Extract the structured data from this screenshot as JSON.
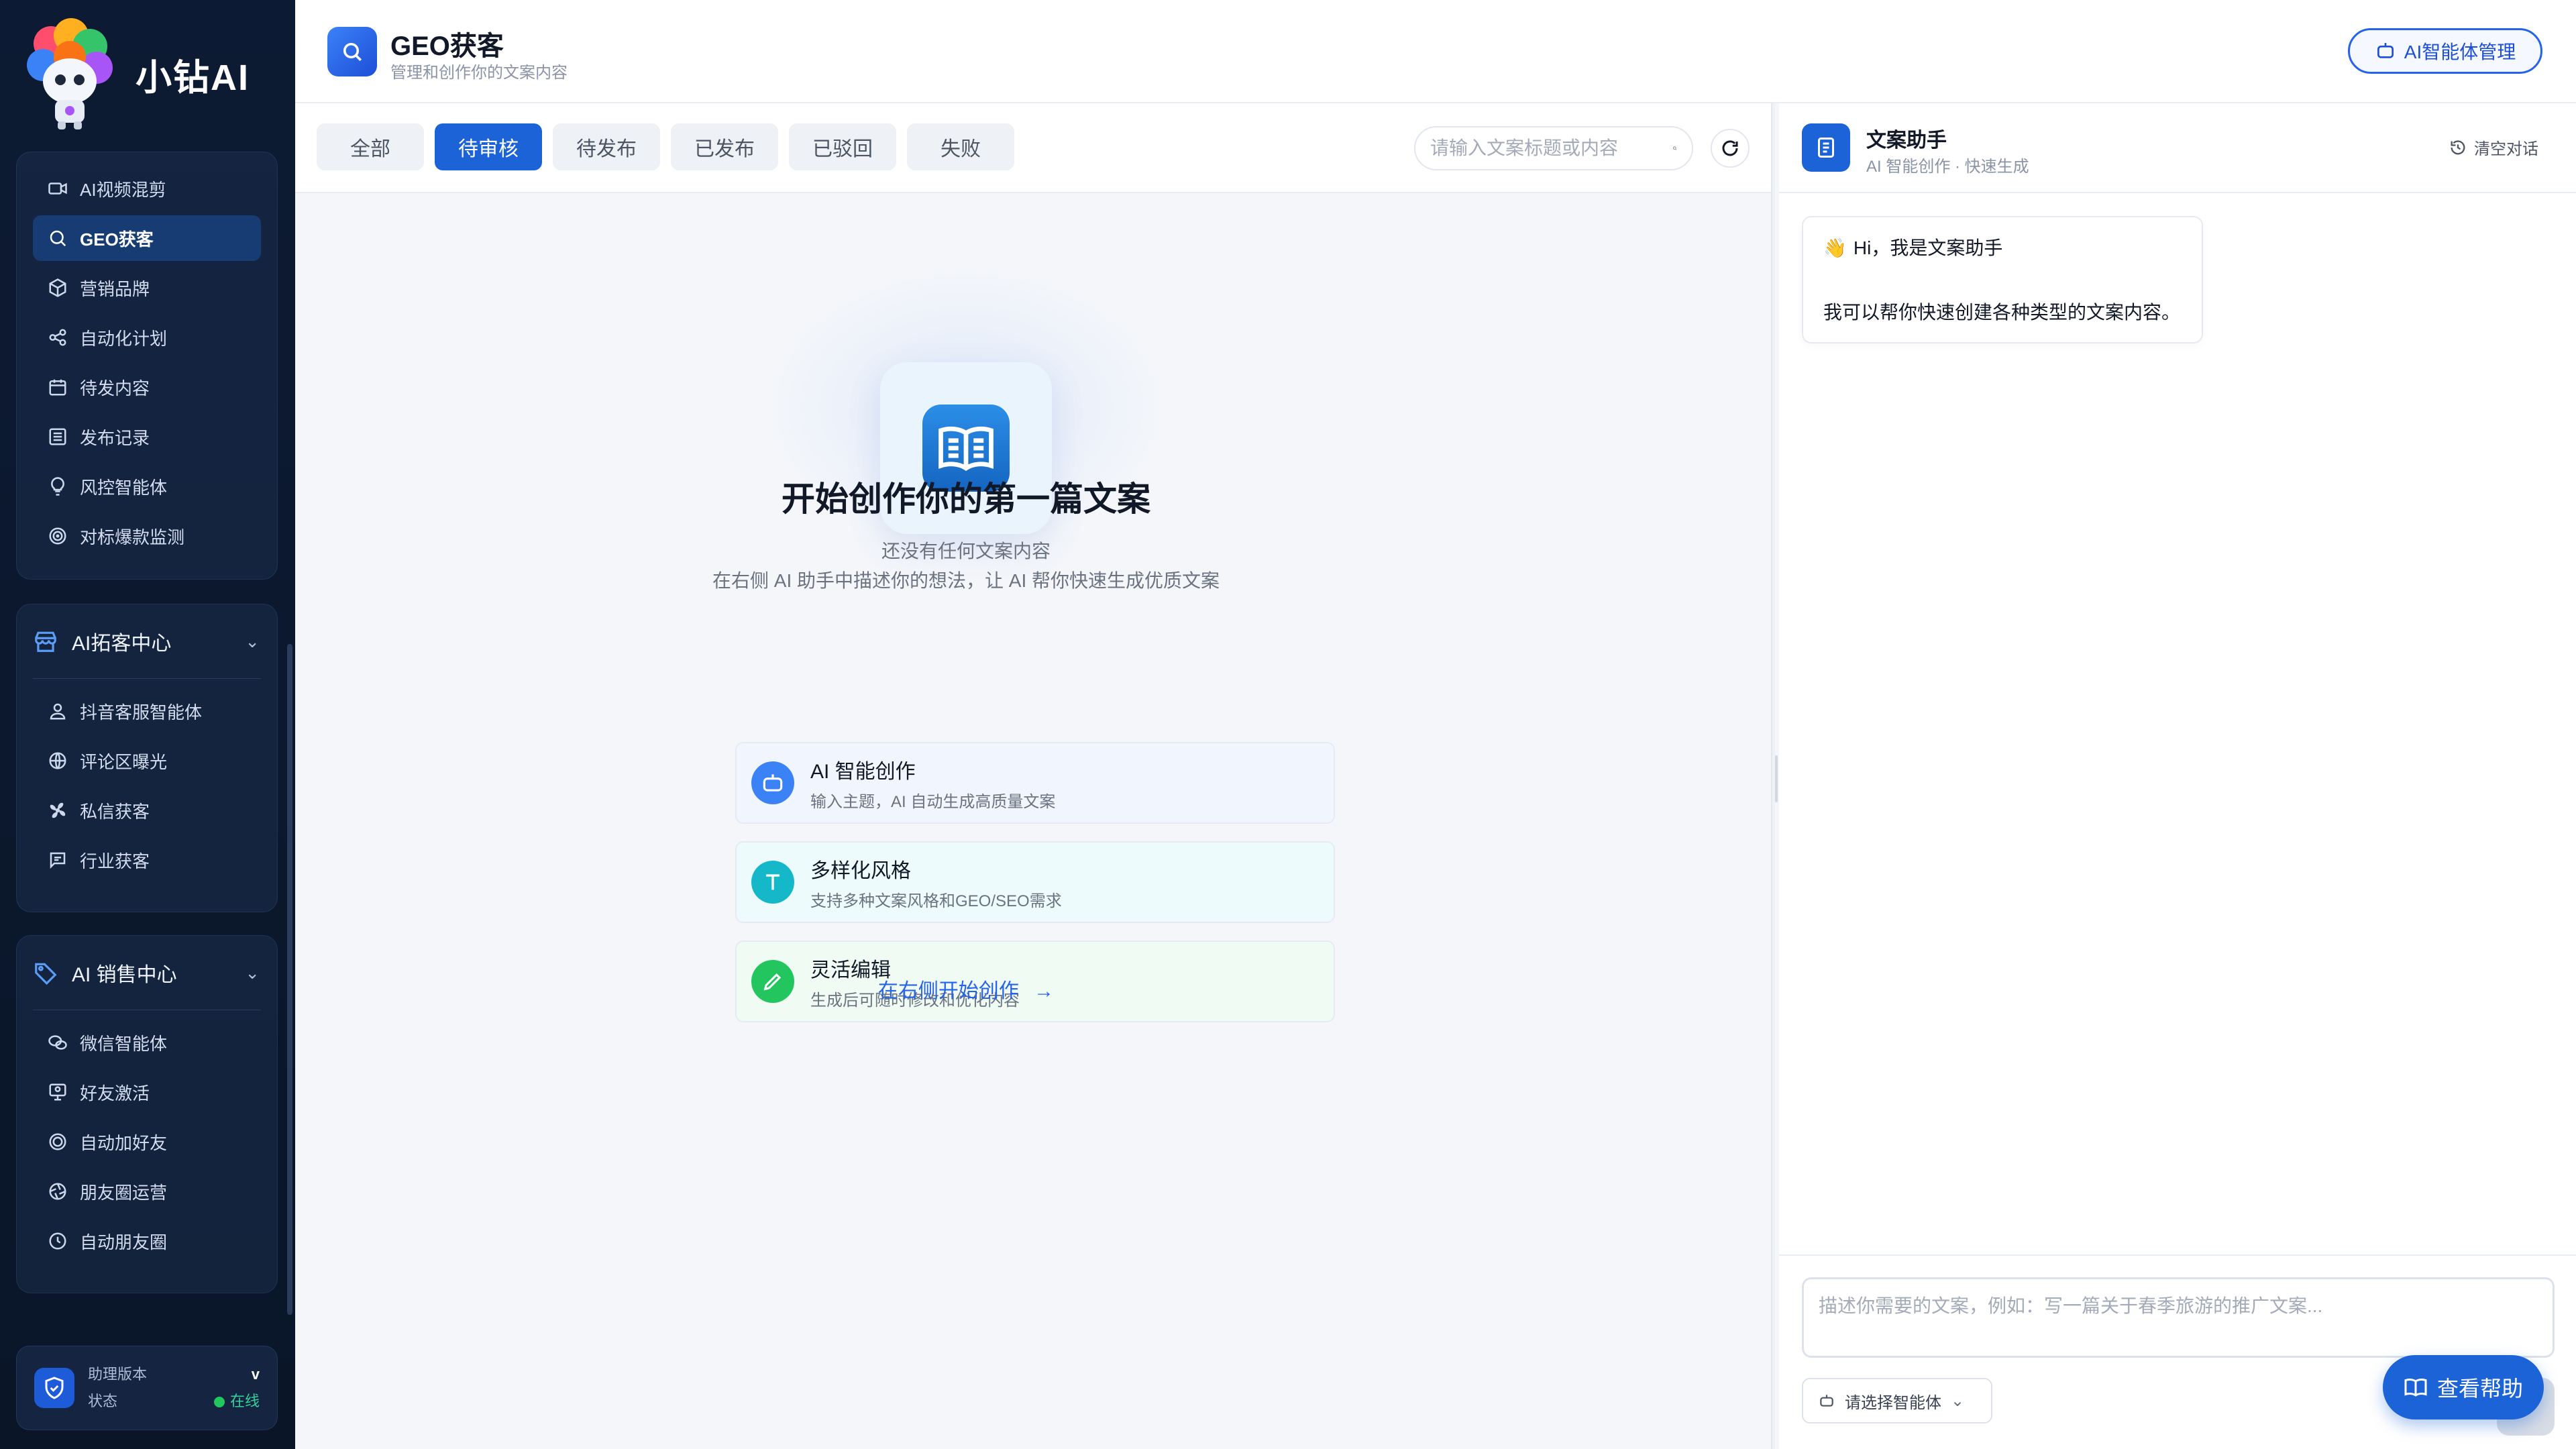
{
  "brand": {
    "name": "小钻AI"
  },
  "sidebar": {
    "group1_items": [
      {
        "label": "AI视频混剪",
        "icon": "video-icon"
      },
      {
        "label": "GEO获客",
        "icon": "search-icon",
        "active": true
      },
      {
        "label": "营销品牌",
        "icon": "box-icon"
      },
      {
        "label": "自动化计划",
        "icon": "share-nodes-icon"
      },
      {
        "label": "待发内容",
        "icon": "calendar-icon"
      },
      {
        "label": "发布记录",
        "icon": "list-icon"
      },
      {
        "label": "风控智能体",
        "icon": "lightbulb-icon"
      },
      {
        "label": "对标爆款监测",
        "icon": "target-icon"
      }
    ],
    "group2": {
      "title": "AI拓客中心",
      "items": [
        {
          "label": "抖音客服智能体",
          "icon": "user-headset-icon"
        },
        {
          "label": "评论区曝光",
          "icon": "globe-icon"
        },
        {
          "label": "私信获客",
          "icon": "fan-icon"
        },
        {
          "label": "行业获客",
          "icon": "message-icon"
        }
      ]
    },
    "group3": {
      "title": "AI 销售中心",
      "items": [
        {
          "label": "微信智能体",
          "icon": "wechat-icon"
        },
        {
          "label": "好友激活",
          "icon": "monitor-user-icon"
        },
        {
          "label": "自动加好友",
          "icon": "circle-plus-icon"
        },
        {
          "label": "朋友圈运营",
          "icon": "aperture-icon"
        },
        {
          "label": "自动朋友圈",
          "icon": "clock-icon"
        }
      ]
    },
    "status": {
      "version_label": "助理版本",
      "version_value": "v",
      "status_label": "状态",
      "status_value": "在线"
    }
  },
  "header": {
    "title": "GEO获客",
    "subtitle": "管理和创作你的文案内容",
    "agent_mgmt_label": "AI智能体管理"
  },
  "tabs": [
    {
      "label": "全部"
    },
    {
      "label": "待审核",
      "active": true
    },
    {
      "label": "待发布"
    },
    {
      "label": "已发布"
    },
    {
      "label": "已驳回"
    },
    {
      "label": "失败"
    }
  ],
  "search": {
    "placeholder": "请输入文案标题或内容",
    "value": ""
  },
  "empty": {
    "title": "开始创作你的第一篇文案",
    "line1": "还没有任何文案内容",
    "line2": "在右侧 AI 助手中描述你的想法，让 AI 帮你快速生成优质文案",
    "features": [
      {
        "title": "AI 智能创作",
        "desc": "输入主题，AI 自动生成高质量文案",
        "icon": "robot-icon",
        "color": "#3b82f6"
      },
      {
        "title": "多样化风格",
        "desc": "支持多种文案风格和GEO/SEO需求",
        "icon": "text-t-icon",
        "color": "#14b8c8"
      },
      {
        "title": "灵活编辑",
        "desc": "生成后可随时修改和优化内容",
        "icon": "pencil-icon",
        "color": "#22c55e"
      }
    ],
    "start_link": "在右侧开始创作"
  },
  "assistant": {
    "title": "文案助手",
    "subtitle": "AI 智能创作 · 快速生成",
    "clear_label": "清空对话",
    "greeting": "Hi，我是文案助手",
    "intro": "我可以帮你快速创建各种类型的文案内容。",
    "input_placeholder": "描述你需要的文案，例如：写一篇关于春季旅游的推广文案...",
    "input_value": "",
    "agent_select_label": "请选择智能体"
  },
  "help_label": "查看帮助",
  "colors": {
    "primary": "#1d63d8",
    "sidebar_bg": "#0c1a33",
    "online": "#22c55e"
  }
}
